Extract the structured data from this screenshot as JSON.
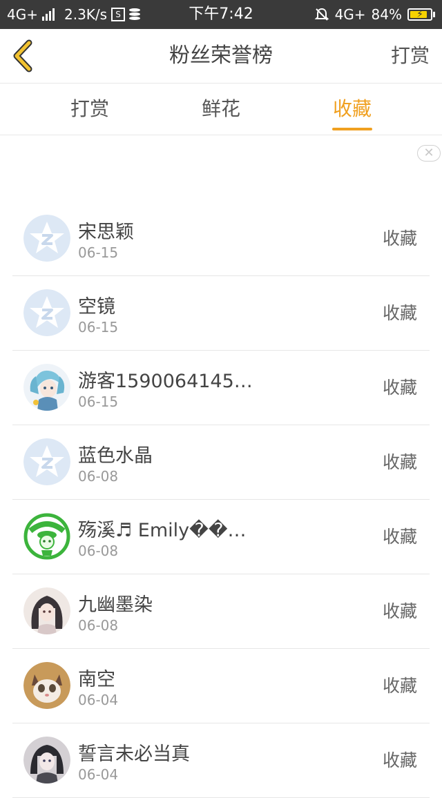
{
  "status_bar": {
    "network": "4G+",
    "speed": "2.3K/s",
    "time": "下午7:42",
    "network2": "4G+",
    "battery": "84%",
    "battery_level": 0.84
  },
  "header": {
    "title": "粉丝荣誉榜",
    "right_action": "打赏"
  },
  "tabs": [
    {
      "label": "打赏",
      "active": false
    },
    {
      "label": "鲜花",
      "active": false
    },
    {
      "label": "收藏",
      "active": true
    }
  ],
  "list": [
    {
      "name": "宋思颖",
      "date": "06-15",
      "action": "收藏",
      "avatar": "default-star"
    },
    {
      "name": "空镜",
      "date": "06-15",
      "action": "收藏",
      "avatar": "default-star"
    },
    {
      "name": "游客1590064145…",
      "date": "06-15",
      "action": "收藏",
      "avatar": "anime-blue"
    },
    {
      "name": "蓝色水晶",
      "date": "06-08",
      "action": "收藏",
      "avatar": "default-star"
    },
    {
      "name": "殇溪♬ Emily��…",
      "date": "06-08",
      "action": "收藏",
      "avatar": "green-badge"
    },
    {
      "name": "九幽墨染",
      "date": "06-08",
      "action": "收藏",
      "avatar": "anime-girl"
    },
    {
      "name": "南空",
      "date": "06-04",
      "action": "收藏",
      "avatar": "cat"
    },
    {
      "name": "誓言未必当真",
      "date": "06-04",
      "action": "收藏",
      "avatar": "anime-dark"
    }
  ],
  "colors": {
    "accent": "#f0a020",
    "status_bar": "#3a3a3a",
    "default_avatar": "#dde8f5"
  }
}
